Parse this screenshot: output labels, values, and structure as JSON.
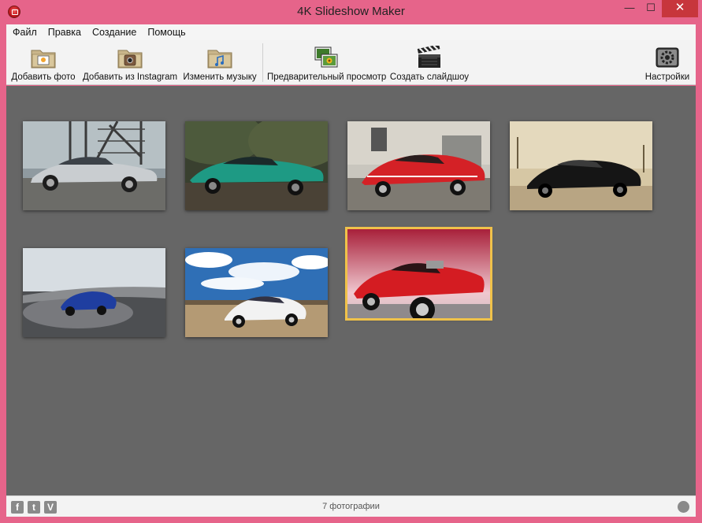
{
  "window": {
    "title": "4K Slideshow Maker"
  },
  "controls": {
    "minimize": "—",
    "maximize": "☐",
    "close": "✕"
  },
  "menu": {
    "items": [
      {
        "label": "Файл"
      },
      {
        "label": "Правка"
      },
      {
        "label": "Создание"
      },
      {
        "label": "Помощь"
      }
    ]
  },
  "toolbar": {
    "add_photo": "Добавить фото",
    "add_instagram": "Добавить из Instagram",
    "change_music": "Изменить музыку",
    "preview": "Предварительный просмотр",
    "create_slideshow": "Создать слайдшоу",
    "settings": "Настройки"
  },
  "photos": {
    "items": [
      {
        "scene": "silver-car-industrial",
        "selected": false
      },
      {
        "scene": "teal-car-trees",
        "selected": false
      },
      {
        "scene": "red-car-building",
        "selected": false
      },
      {
        "scene": "black-car-sepia",
        "selected": false
      },
      {
        "scene": "blue-car-road",
        "selected": false
      },
      {
        "scene": "white-car-sky",
        "selected": false
      },
      {
        "scene": "red-classic-car",
        "selected": true
      }
    ]
  },
  "status": {
    "count_text": "7 фотографии",
    "social": {
      "facebook": "f",
      "twitter": "t",
      "vimeo": "V"
    }
  },
  "colors": {
    "frame": "#e6648a",
    "close_button": "#c7363c",
    "canvas": "#666666",
    "selection": "#f0c24a"
  }
}
